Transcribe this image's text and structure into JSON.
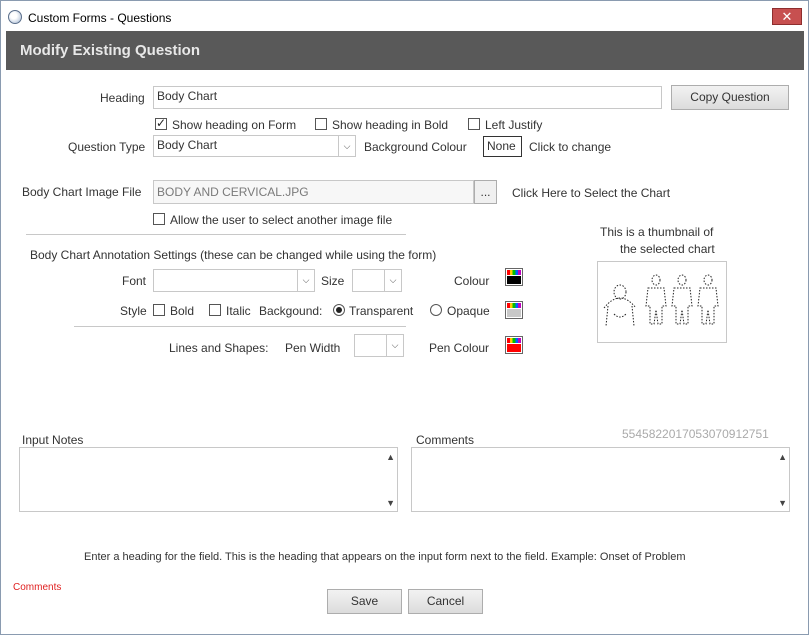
{
  "window": {
    "title": "Custom Forms - Questions",
    "close_label": "✕"
  },
  "banner": {
    "title": "Modify Existing Question"
  },
  "form": {
    "heading_label": "Heading",
    "heading_value": "Body Chart",
    "copy_button": "Copy Question",
    "show_heading_label": "Show heading on Form",
    "show_heading_checked": true,
    "show_bold_label": "Show heading in Bold",
    "show_bold_checked": false,
    "left_justify_label": "Left Justify",
    "left_justify_checked": false,
    "question_type_label": "Question Type",
    "question_type_value": "Body Chart",
    "bg_colour_label": "Background Colour",
    "bg_colour_value": "None",
    "bg_colour_hint": "Click to change",
    "image_file_label": "Body Chart Image File",
    "image_file_value": "BODY AND CERVICAL.JPG",
    "browse_label": "...",
    "select_chart_hint": "Click Here to Select the Chart",
    "allow_other_label": "Allow the user to select another image file",
    "allow_other_checked": false,
    "thumbnail_caption_1": "This is a thumbnail of",
    "thumbnail_caption_2": "the selected chart"
  },
  "annotation": {
    "section_title": "Body Chart Annotation Settings (these can be changed while using the form)",
    "font_label": "Font",
    "font_value": "",
    "size_label": "Size",
    "size_value": "",
    "colour_label": "Colour",
    "colour_fill": "#000000",
    "style_label": "Style",
    "bold_label": "Bold",
    "bold_checked": false,
    "italic_label": "Italic",
    "background_label": "Backgound:",
    "transparent_label": "Transparent",
    "transparent_checked": true,
    "opaque_label": "Opaque",
    "opaque_checked": false,
    "background_fill": "#c8c8c8",
    "lines_label": "Lines and Shapes:",
    "pen_width_label": "Pen Width",
    "pen_width_value": "",
    "pen_colour_label": "Pen Colour",
    "pen_colour_fill": "#ff0000"
  },
  "notes": {
    "input_notes_label": "Input Notes",
    "comments_label": "Comments",
    "id_number": "5545822017053070912751"
  },
  "footer": {
    "help_text": "Enter a heading for the field. This is the heading that appears on the input form next to the field. Example: Onset of Problem",
    "comments_link": "Comments",
    "save_button": "Save",
    "cancel_button": "Cancel"
  },
  "colors": {
    "banner_bg": "#595959",
    "close_bg": "#c75050",
    "comments_red": "#e02020"
  }
}
